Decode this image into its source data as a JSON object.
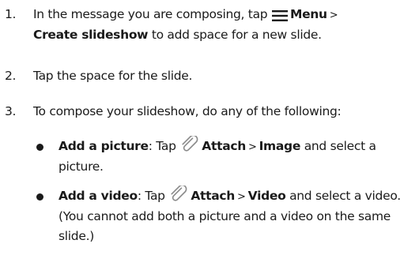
{
  "steps": [
    {
      "number": "1.",
      "text_before": "In the message you are composing, tap ",
      "menu_icon": "menu-icon",
      "menu_label": "Menu",
      "separator": ">",
      "target_label": "Create slideshow",
      "text_after": " to add space for a new slide."
    },
    {
      "number": "2.",
      "text": "Tap the space for the slide."
    },
    {
      "number": "3.",
      "text": "To compose your slideshow, do any of the following:"
    }
  ],
  "bullets": [
    {
      "title": "Add a picture",
      "colon": ": Tap ",
      "icon": "paperclip-icon",
      "attach_label": "Attach",
      "separator": ">",
      "target_label": "Image",
      "text_after": " and select a picture."
    },
    {
      "title": "Add a video",
      "colon": ": Tap ",
      "icon": "paperclip-icon",
      "attach_label": "Attach",
      "separator": ">",
      "target_label": "Video",
      "text_after": " and select a video. (You cannot add both a picture and a video on the same slide.)"
    }
  ]
}
